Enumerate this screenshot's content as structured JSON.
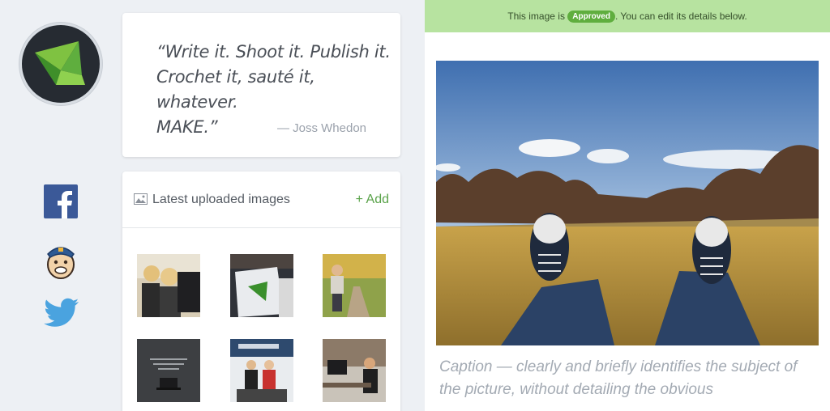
{
  "quote": {
    "lines": [
      "“Write it. Shoot it. Publish it.",
      "Crochet it, sauté it, whatever.",
      "MAKE.”"
    ],
    "author": "— Joss Whedon"
  },
  "images": {
    "title": "Latest uploaded images",
    "add_label": "+ Add",
    "thumbnails": [
      "two-women-laptop",
      "laptop-sticker",
      "woman-garden-path",
      "dark-laptop-quote",
      "firebrand-office",
      "office-desk-worker"
    ]
  },
  "social": [
    "facebook-icon",
    "mailchimp-icon",
    "twitter-icon"
  ],
  "banner": {
    "prefix": "This image is",
    "status": "Approved",
    "suffix": ". You can edit its details below."
  },
  "caption": "Caption — clearly and briefly identifies the subject of the picture, without detailing the obvious",
  "colors": {
    "accent": "#5aa34a",
    "banner": "#b7e3a0",
    "badge": "#5fae3e",
    "logo_bg": "#262b32"
  }
}
